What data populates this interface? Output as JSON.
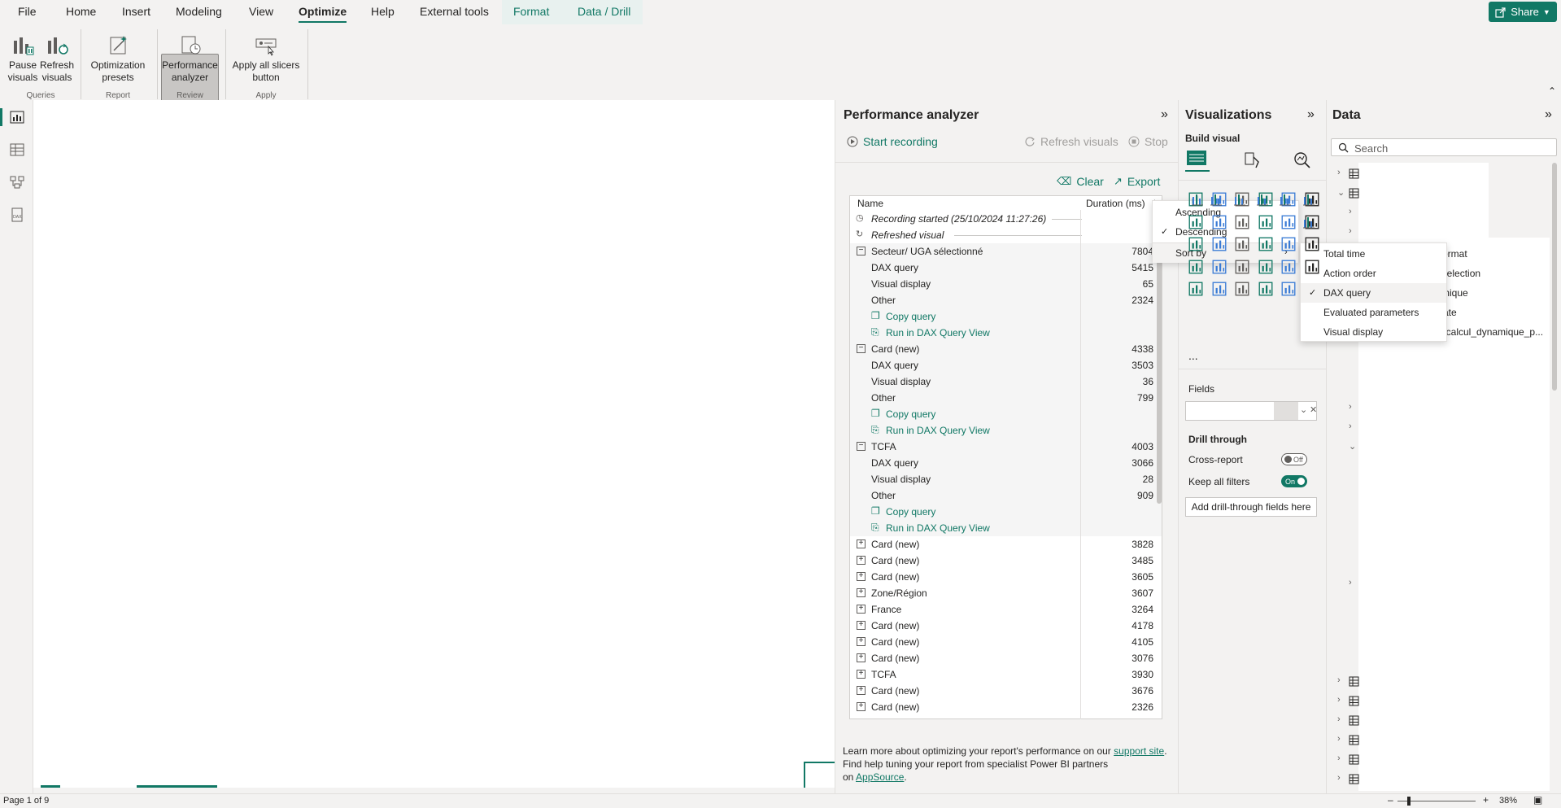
{
  "menubar": {
    "items": [
      "File",
      "Home",
      "Insert",
      "Modeling",
      "View",
      "Optimize",
      "Help",
      "External tools",
      "Format",
      "Data / Drill"
    ],
    "active": "Optimize",
    "share_label": "Share"
  },
  "ribbon": {
    "pause_visuals": "Pause visuals",
    "refresh_visuals": "Refresh visuals",
    "optimization_presets": "Optimization presets",
    "performance_analyzer": "Performance analyzer",
    "apply_slicers": "Apply all slicers button",
    "groups": {
      "queries": "Queries",
      "report": "Report",
      "review": "Review",
      "apply": "Apply"
    }
  },
  "perf": {
    "title": "Performance analyzer",
    "start_recording": "Start recording",
    "refresh_visuals": "Refresh visuals",
    "stop": "Stop",
    "clear": "Clear",
    "export": "Export",
    "col_name": "Name",
    "col_duration": "Duration (ms)",
    "rows": [
      {
        "name": "Recording started (25/10/2024 11:27:26)",
        "dur": "",
        "kind": "event"
      },
      {
        "name": "Refreshed visual",
        "dur": "",
        "kind": "event"
      },
      {
        "name": "Secteur/ UGA sélectionné",
        "dur": "7804",
        "kind": "group-open"
      },
      {
        "name": "DAX query",
        "dur": "5415",
        "kind": "child"
      },
      {
        "name": "Visual display",
        "dur": "65",
        "kind": "child"
      },
      {
        "name": "Other",
        "dur": "2324",
        "kind": "child"
      },
      {
        "name": "Copy query",
        "dur": "",
        "kind": "link-copy"
      },
      {
        "name": "Run in DAX Query View",
        "dur": "",
        "kind": "link-run"
      },
      {
        "name": "Card (new)",
        "dur": "4338",
        "kind": "group-open"
      },
      {
        "name": "DAX query",
        "dur": "3503",
        "kind": "child"
      },
      {
        "name": "Visual display",
        "dur": "36",
        "kind": "child"
      },
      {
        "name": "Other",
        "dur": "799",
        "kind": "child"
      },
      {
        "name": "Copy query",
        "dur": "",
        "kind": "link-copy"
      },
      {
        "name": "Run in DAX Query View",
        "dur": "",
        "kind": "link-run"
      },
      {
        "name": "TCFA",
        "dur": "4003",
        "kind": "group-open"
      },
      {
        "name": "DAX query",
        "dur": "3066",
        "kind": "child"
      },
      {
        "name": "Visual display",
        "dur": "28",
        "kind": "child"
      },
      {
        "name": "Other",
        "dur": "909",
        "kind": "child"
      },
      {
        "name": "Copy query",
        "dur": "",
        "kind": "link-copy"
      },
      {
        "name": "Run in DAX Query View",
        "dur": "",
        "kind": "link-run"
      },
      {
        "name": "Card (new)",
        "dur": "3828",
        "kind": "group"
      },
      {
        "name": "Card (new)",
        "dur": "3485",
        "kind": "group"
      },
      {
        "name": "Card (new)",
        "dur": "3605",
        "kind": "group"
      },
      {
        "name": "Zone/Région",
        "dur": "3607",
        "kind": "group"
      },
      {
        "name": "France",
        "dur": "3264",
        "kind": "group"
      },
      {
        "name": "Card (new)",
        "dur": "4178",
        "kind": "group"
      },
      {
        "name": "Card (new)",
        "dur": "4105",
        "kind": "group"
      },
      {
        "name": "Card (new)",
        "dur": "3076",
        "kind": "group"
      },
      {
        "name": "TCFA",
        "dur": "3930",
        "kind": "group"
      },
      {
        "name": "Card (new)",
        "dur": "3676",
        "kind": "group"
      },
      {
        "name": "Card (new)",
        "dur": "2326",
        "kind": "group"
      }
    ],
    "footer": {
      "line1": "Learn more about optimizing your report's performance on our",
      "support_link": "support site",
      "line1_end": ".",
      "line2": "Find help tuning your report from specialist Power BI partners",
      "line3": "on",
      "appsource_link": "AppSource",
      "line3_end": "."
    }
  },
  "sort_menu": {
    "ascending": "Ascending",
    "descending": "Descending",
    "sort_by": "Sort by"
  },
  "sortby_menu": {
    "items": [
      "Total time",
      "Action order",
      "DAX query",
      "Evaluated parameters",
      "Visual display"
    ],
    "selected": "DAX query"
  },
  "viz": {
    "title": "Visualizations",
    "build_visual": "Build visual",
    "fields": "Fields",
    "drill_through": "Drill through",
    "cross_report": "Cross-report",
    "cross_report_state": "Off",
    "keep_filters": "Keep all filters",
    "keep_filters_state": "On",
    "add_drill": "Add drill-through fields here",
    "more": "..."
  },
  "data": {
    "title": "Data",
    "search_placeholder": "Search",
    "partial_labels": [
      "_format",
      "_selection",
      "mique",
      "ate",
      "r_calcul_dynamique_p..."
    ]
  },
  "status": {
    "page": "Page 1 of 9",
    "zoom": "38%"
  },
  "colors": {
    "accent": "#117865"
  }
}
